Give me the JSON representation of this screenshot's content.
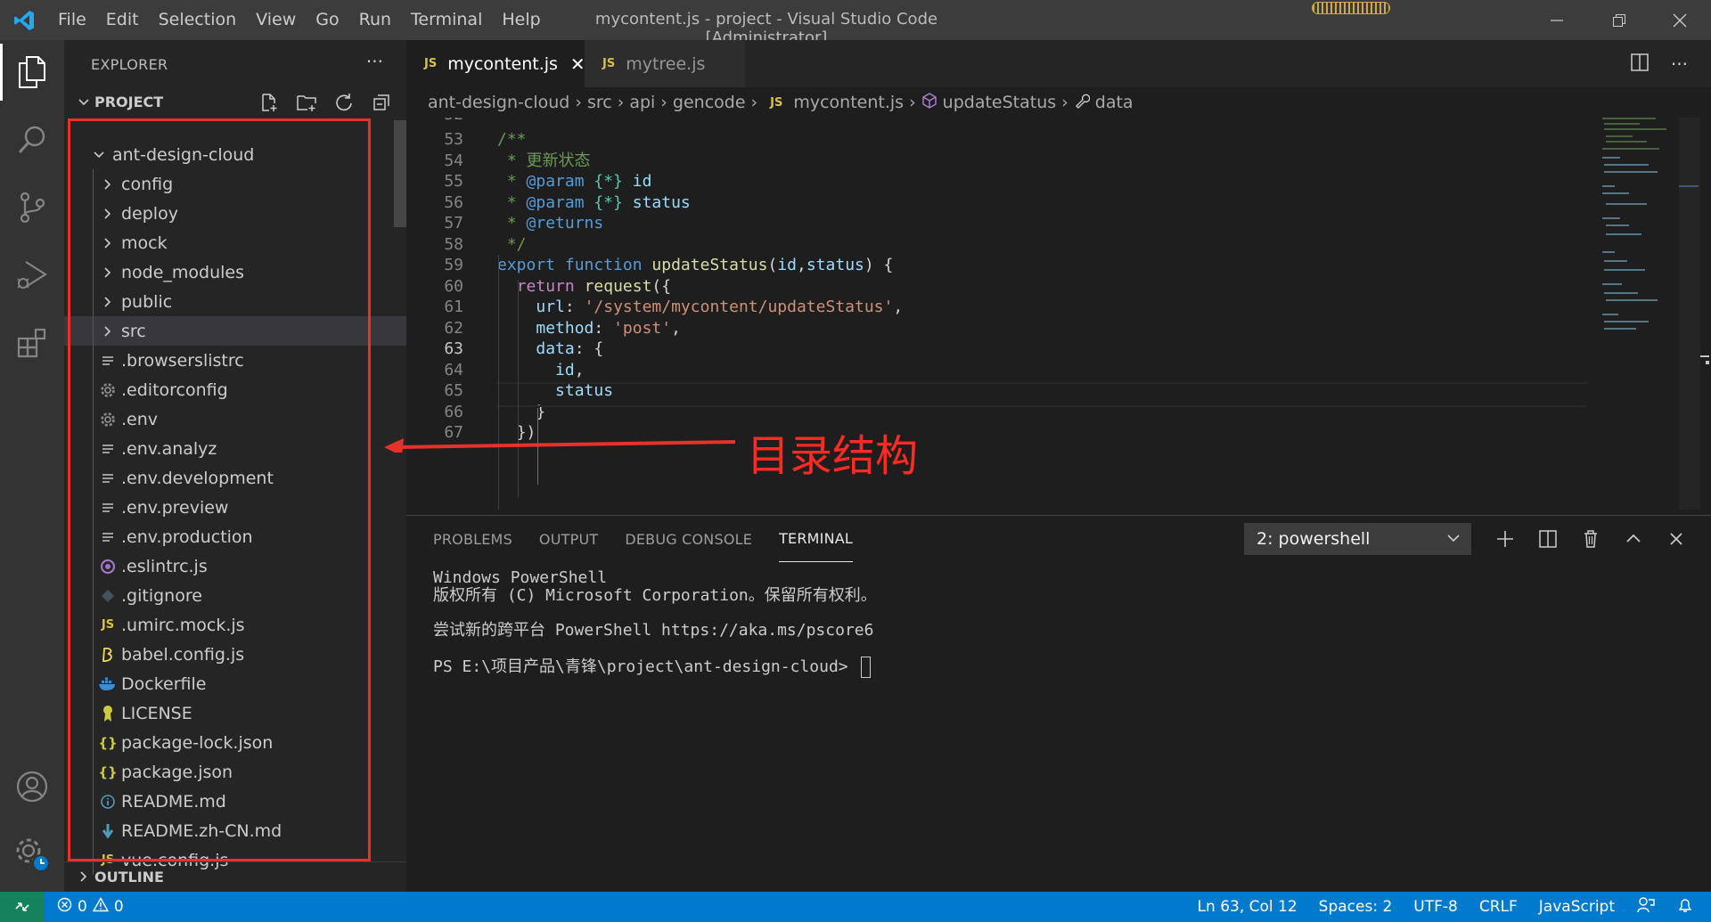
{
  "titlebar": {
    "menu": [
      "File",
      "Edit",
      "Selection",
      "View",
      "Go",
      "Run",
      "Terminal",
      "Help"
    ],
    "window_title": "mycontent.js - project - Visual Studio Code [Administrator]"
  },
  "activity": [
    "explorer-icon",
    "search-icon",
    "source-control-icon",
    "run-debug-icon",
    "extensions-icon",
    "accounts-icon",
    "manage-gear-icon"
  ],
  "sidebar": {
    "title": "EXPLORER",
    "more": "···",
    "section": "PROJECT",
    "root": "ant-design-cloud",
    "items": [
      {
        "name": "config",
        "kind": "folder"
      },
      {
        "name": "deploy",
        "kind": "folder"
      },
      {
        "name": "mock",
        "kind": "folder"
      },
      {
        "name": "node_modules",
        "kind": "folder"
      },
      {
        "name": "public",
        "kind": "folder"
      },
      {
        "name": "src",
        "kind": "folder"
      },
      {
        "name": ".browserslistrc",
        "kind": "lines"
      },
      {
        "name": ".editorconfig",
        "kind": "gear"
      },
      {
        "name": ".env",
        "kind": "gear"
      },
      {
        "name": ".env.analyz",
        "kind": "lines"
      },
      {
        "name": ".env.development",
        "kind": "lines"
      },
      {
        "name": ".env.preview",
        "kind": "lines"
      },
      {
        "name": ".env.production",
        "kind": "lines"
      },
      {
        "name": ".eslintrc.js",
        "kind": "eslint"
      },
      {
        "name": ".gitignore",
        "kind": "git"
      },
      {
        "name": ".umirc.mock.js",
        "kind": "js"
      },
      {
        "name": "babel.config.js",
        "kind": "babel"
      },
      {
        "name": "Dockerfile",
        "kind": "docker"
      },
      {
        "name": "LICENSE",
        "kind": "license"
      },
      {
        "name": "package-lock.json",
        "kind": "json"
      },
      {
        "name": "package.json",
        "kind": "json"
      },
      {
        "name": "README.md",
        "kind": "info"
      },
      {
        "name": "README.zh-CN.md",
        "kind": "markdown"
      },
      {
        "name": "vue.config.js",
        "kind": "js"
      }
    ],
    "outline": "OUTLINE"
  },
  "annotation": {
    "label": "目录结构",
    "color": "#e8312a"
  },
  "tabs": [
    {
      "label": "mycontent.js",
      "badge": "JS",
      "active": true,
      "close": "✕"
    },
    {
      "label": "mytree.js",
      "badge": "JS",
      "active": false
    }
  ],
  "breadcrumb": [
    "ant-design-cloud",
    "src",
    "api",
    "gencode",
    "mycontent.js",
    "updateStatus",
    "data"
  ],
  "editor": {
    "lines": [
      {
        "n": 53,
        "tokens": [
          [
            "/**",
            "cm"
          ]
        ]
      },
      {
        "n": 54,
        "tokens": [
          [
            " * 更新状态",
            "cm"
          ]
        ]
      },
      {
        "n": 55,
        "tokens": [
          [
            " * ",
            "cm"
          ],
          [
            "@param",
            "doc"
          ],
          [
            " {*} ",
            "type"
          ],
          [
            "id",
            "var"
          ]
        ]
      },
      {
        "n": 56,
        "tokens": [
          [
            " * ",
            "cm"
          ],
          [
            "@param",
            "doc"
          ],
          [
            " {*} ",
            "type"
          ],
          [
            "status",
            "var"
          ]
        ]
      },
      {
        "n": 57,
        "tokens": [
          [
            " * ",
            "cm"
          ],
          [
            "@returns",
            "doc"
          ]
        ]
      },
      {
        "n": 58,
        "tokens": [
          [
            " */",
            "cm"
          ]
        ]
      },
      {
        "n": 59,
        "tokens": [
          [
            "export",
            "kw"
          ],
          [
            " ",
            "pun"
          ],
          [
            "function",
            "kw"
          ],
          [
            " ",
            "pun"
          ],
          [
            "updateStatus",
            "fn"
          ],
          [
            "(",
            "pun"
          ],
          [
            "id",
            "var"
          ],
          [
            ",",
            "pun"
          ],
          [
            "status",
            "var"
          ],
          [
            ") {",
            "pun"
          ]
        ]
      },
      {
        "n": 60,
        "tokens": [
          [
            "  ",
            "pun"
          ],
          [
            "return",
            "kw2"
          ],
          [
            " ",
            "pun"
          ],
          [
            "request",
            "fn"
          ],
          [
            "({",
            "pun"
          ]
        ]
      },
      {
        "n": 61,
        "tokens": [
          [
            "    ",
            "pun"
          ],
          [
            "url",
            "var"
          ],
          [
            ": ",
            "pun"
          ],
          [
            "'/system/mycontent/updateStatus'",
            "str"
          ],
          [
            ",",
            "pun"
          ]
        ]
      },
      {
        "n": 62,
        "tokens": [
          [
            "    ",
            "pun"
          ],
          [
            "method",
            "var"
          ],
          [
            ": ",
            "pun"
          ],
          [
            "'post'",
            "str"
          ],
          [
            ",",
            "pun"
          ]
        ]
      },
      {
        "n": 63,
        "tokens": [
          [
            "    ",
            "pun"
          ],
          [
            "data",
            "var"
          ],
          [
            ": {",
            "pun"
          ]
        ]
      },
      {
        "n": 64,
        "tokens": [
          [
            "      ",
            "pun"
          ],
          [
            "id",
            "var"
          ],
          [
            ",",
            "pun"
          ]
        ]
      },
      {
        "n": 65,
        "tokens": [
          [
            "      ",
            "pun"
          ],
          [
            "status",
            "var"
          ]
        ]
      },
      {
        "n": 66,
        "tokens": [
          [
            "    }",
            "pun"
          ]
        ]
      },
      {
        "n": 67,
        "tokens": [
          [
            "  })",
            "pun"
          ]
        ]
      }
    ]
  },
  "panel": {
    "tabs": [
      "PROBLEMS",
      "OUTPUT",
      "DEBUG CONSOLE",
      "TERMINAL"
    ],
    "active_tab": "TERMINAL",
    "terminal_select": "2: powershell",
    "terminal_lines": [
      "Windows PowerShell",
      "版权所有 (C) Microsoft Corporation。保留所有权利。",
      "",
      "尝试新的跨平台 PowerShell https://aka.ms/pscore6",
      "",
      "PS E:\\项目产品\\青锋\\project\\ant-design-cloud> "
    ]
  },
  "statusbar": {
    "errors": "0",
    "warnings": "0",
    "position": "Ln 63, Col 12",
    "spaces": "Spaces: 2",
    "encoding": "UTF-8",
    "eol": "CRLF",
    "language": "JavaScript"
  }
}
